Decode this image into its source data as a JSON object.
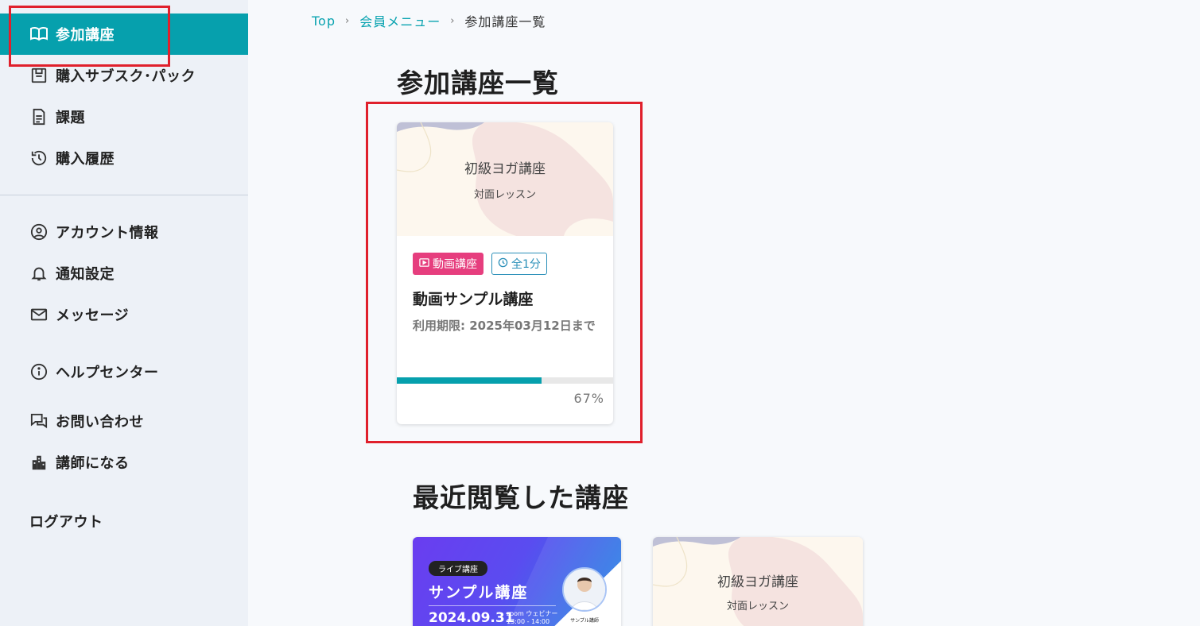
{
  "sidebar": {
    "items": [
      {
        "label": "参加講座",
        "icon": "book-open-icon"
      },
      {
        "label": "購入サブスク･パック",
        "icon": "package-icon"
      },
      {
        "label": "課題",
        "icon": "document-icon"
      },
      {
        "label": "購入履歴",
        "icon": "history-icon"
      },
      {
        "label": "アカウント情報",
        "icon": "user-circle-icon"
      },
      {
        "label": "通知設定",
        "icon": "bell-icon"
      },
      {
        "label": "メッセージ",
        "icon": "mail-icon"
      },
      {
        "label": "ヘルプセンター",
        "icon": "info-icon"
      },
      {
        "label": "お問い合わせ",
        "icon": "chat-icon"
      },
      {
        "label": "講師になる",
        "icon": "building-icon"
      }
    ],
    "logout": "ログアウト",
    "active_color": "#06a0ad"
  },
  "breadcrumb": {
    "home": "Top",
    "member_menu": "会員メニュー",
    "current": "参加講座一覧",
    "separator": "›"
  },
  "page_title": "参加講座一覧",
  "enrolled_course": {
    "thumb_title": "初級ヨガ講座",
    "thumb_subtitle": "対面レッスン",
    "type_tag": "動画講座",
    "duration_tag": "全1分",
    "title": "動画サンプル講座",
    "expiry": "利用期限: 2025年03月12日まで",
    "progress_text": "67%",
    "progress": 0.67
  },
  "recent_title": "最近閲覧した講座",
  "recent_courses": [
    {
      "badge": "ライブ講座",
      "title": "サンプル講座",
      "date": "2024.09.31",
      "zoom_line1": "zoom ウェビナー",
      "zoom_line2": "13:00 - 14:00",
      "instructor": "サンプル講師"
    },
    {
      "thumb_title": "初級ヨガ講座",
      "thumb_subtitle": "対面レッスン"
    }
  ],
  "colors": {
    "accent": "#06a0ad",
    "video_tag": "#e63e7e",
    "duration_tag": "#2a8fb8",
    "highlight": "#e0202c"
  }
}
